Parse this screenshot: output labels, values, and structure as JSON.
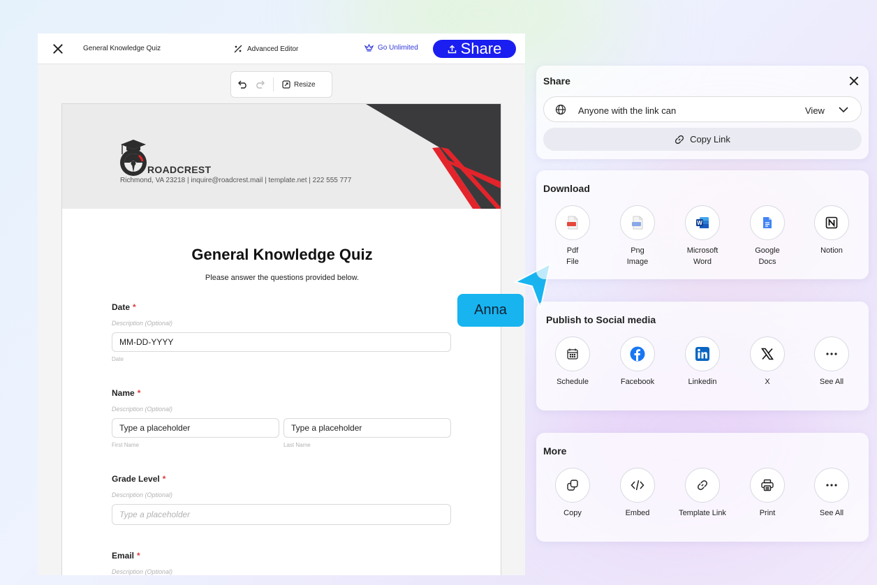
{
  "editor": {
    "doc_title": "General Knowledge Quiz",
    "advanced_editor": "Advanced Editor",
    "go_unlimited": "Go Unlimited",
    "share": "Share",
    "resize": "Resize"
  },
  "document": {
    "brand": "ROADCREST",
    "address": "Richmond, VA 23218 | inquire@roadcrest.mail | template.net | 222 555 777",
    "title": "General Knowledge Quiz",
    "subtitle": "Please answer the questions provided below.",
    "fields": {
      "date": {
        "label": "Date",
        "required": "*",
        "desc": "Description (Optional)",
        "value": "MM-DD-YYYY",
        "sub": "Date"
      },
      "name": {
        "label": "Name",
        "required": "*",
        "desc": "Description (Optional)",
        "first": "Type a placeholder",
        "last": "Type a placeholder",
        "first_sub": "First Name",
        "last_sub": "Last Name"
      },
      "grade": {
        "label": "Grade Level",
        "required": "*",
        "desc": "Description (Optional)",
        "placeholder": "Type a placeholder"
      },
      "email": {
        "label": "Email",
        "required": "*",
        "desc": "Description (Optional)"
      }
    }
  },
  "cursor_label": "Anna",
  "share_panel": {
    "title": "Share",
    "access_text": "Anyone with the link can",
    "access_level": "View",
    "copy_link": "Copy Link"
  },
  "download": {
    "title": "Download",
    "items": [
      {
        "line1": "Pdf",
        "line2": "File",
        "icon": "pdf-file-icon"
      },
      {
        "line1": "Png",
        "line2": "Image",
        "icon": "png-image-icon"
      },
      {
        "line1": "Microsoft",
        "line2": "Word",
        "icon": "microsoft-word-icon"
      },
      {
        "line1": "Google",
        "line2": "Docs",
        "icon": "google-docs-icon"
      },
      {
        "line1": "Notion",
        "line2": "",
        "icon": "notion-icon"
      }
    ]
  },
  "social": {
    "title": "Publish to Social media",
    "items": [
      {
        "label": "Schedule",
        "icon": "calendar-icon"
      },
      {
        "label": "Facebook",
        "icon": "facebook-icon"
      },
      {
        "label": "Linkedin",
        "icon": "linkedin-icon"
      },
      {
        "label": "X",
        "icon": "x-icon"
      },
      {
        "label": "See All",
        "icon": "more-icon"
      }
    ]
  },
  "more": {
    "title": "More",
    "items": [
      {
        "label": "Copy",
        "icon": "copy-icon"
      },
      {
        "label": "Embed",
        "icon": "code-icon"
      },
      {
        "label": "Template Link",
        "icon": "link-icon"
      },
      {
        "label": "Print",
        "icon": "printer-icon"
      },
      {
        "label": "See All",
        "icon": "more-icon"
      }
    ]
  },
  "colors": {
    "primary": "#1a1ef0",
    "accent_link": "#2f37d9",
    "cursor": "#17b4f0",
    "required": "#e03a3a",
    "header_red": "#e3242b",
    "header_dark": "#3a3a3c"
  }
}
